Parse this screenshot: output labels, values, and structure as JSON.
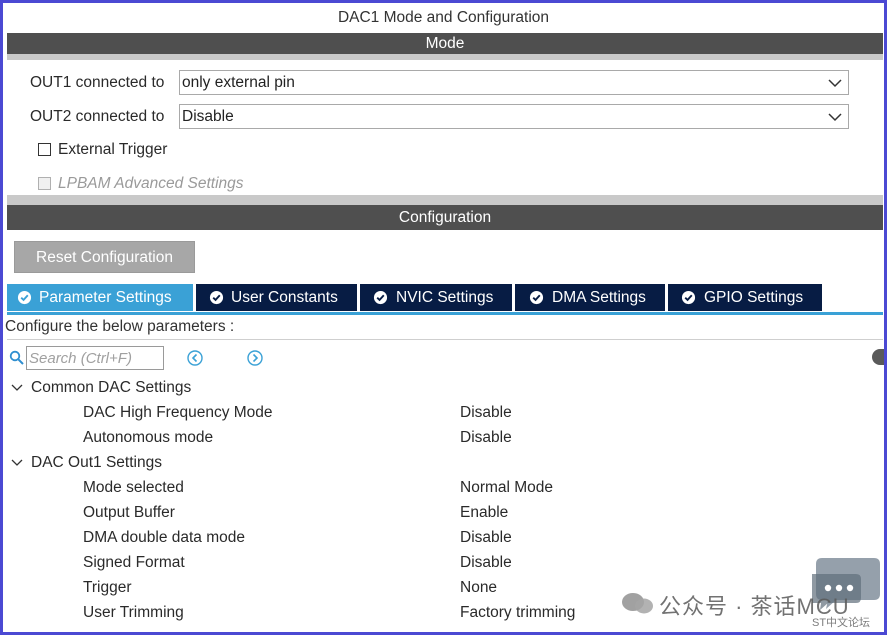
{
  "window": {
    "title": "DAC1 Mode and Configuration"
  },
  "mode": {
    "header": "Mode",
    "out1": {
      "label": "OUT1 connected to",
      "value": "only external pin"
    },
    "out2": {
      "label": "OUT2 connected to",
      "value": "Disable"
    },
    "external_trigger": {
      "label": "External Trigger",
      "checked": false
    },
    "lpbam": {
      "label": "LPBAM Advanced Settings",
      "checked": false,
      "disabled": true
    }
  },
  "configuration": {
    "header": "Configuration",
    "reset_label": "Reset Configuration",
    "tabs": [
      {
        "label": "Parameter Settings",
        "active": true,
        "icon": "check-circle-icon"
      },
      {
        "label": "User Constants",
        "active": false,
        "icon": "check-circle-icon"
      },
      {
        "label": "NVIC Settings",
        "active": false,
        "icon": "check-circle-icon"
      },
      {
        "label": "DMA Settings",
        "active": false,
        "icon": "check-circle-icon"
      },
      {
        "label": "GPIO Settings",
        "active": false,
        "icon": "check-circle-icon"
      }
    ],
    "instruction": "Configure the below parameters :",
    "search_placeholder": "Search (Ctrl+F)",
    "groups": [
      {
        "title": "Common DAC Settings",
        "expanded": true,
        "params": [
          {
            "name": "DAC High Frequency Mode",
            "value": "Disable"
          },
          {
            "name": "Autonomous mode",
            "value": "Disable"
          }
        ]
      },
      {
        "title": "DAC Out1 Settings",
        "expanded": true,
        "params": [
          {
            "name": "Mode selected",
            "value": "Normal Mode"
          },
          {
            "name": "Output Buffer",
            "value": "Enable"
          },
          {
            "name": "DMA double data mode",
            "value": "Disable"
          },
          {
            "name": "Signed Format",
            "value": "Disable"
          },
          {
            "name": "Trigger",
            "value": "None"
          },
          {
            "name": "User Trimming",
            "value": "Factory trimming"
          }
        ]
      }
    ]
  },
  "watermark": {
    "text": "公众号 · 茶话MCU",
    "sub": "ST中文论坛"
  },
  "colors": {
    "frame_border": "#4b49d3",
    "section_bar": "#4f4f4f",
    "tab_active": "#3aa1d6",
    "tab_inactive": "#071c44",
    "reset_button": "#a7a7a7",
    "nav_arrow": "#3aa1d6"
  }
}
